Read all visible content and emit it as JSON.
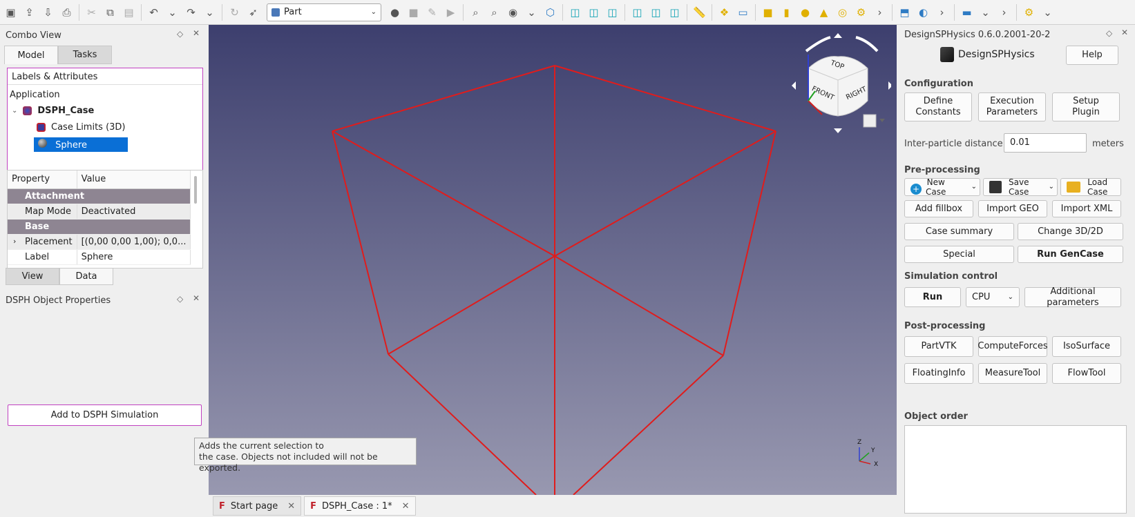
{
  "toolbar": {
    "workbench": "Part",
    "icons": [
      "new-file",
      "open-file",
      "save-file",
      "print",
      "cut",
      "copy",
      "paste",
      "undo",
      "dropdown",
      "redo",
      "dropdown",
      "refresh",
      "whats-this",
      "record-macro",
      "stop-macro",
      "edit-macro",
      "run-macro",
      "zoom-fit",
      "zoom-select",
      "draw-style",
      "view-iso",
      "view-front",
      "view-top",
      "view-right",
      "view-rear",
      "view-bottom",
      "view-left",
      "measure",
      "create-part",
      "create-group",
      "box",
      "cylinder",
      "sphere",
      "cone",
      "torus",
      "primitives",
      "more",
      "boolean",
      "shape-builder",
      "more",
      "view-box",
      "dropdown",
      "more",
      "screenshot",
      "dropdown"
    ]
  },
  "left": {
    "combo_title": "Combo View",
    "tab_model": "Model",
    "tab_tasks": "Tasks",
    "tree_header": "Labels & Attributes",
    "app_label": "Application",
    "tree": {
      "root": "DSPH_Case",
      "child1": "Case Limits (3D)",
      "child2": "Sphere"
    },
    "props": {
      "col_property": "Property",
      "col_value": "Value",
      "group1": "Attachment",
      "map_mode_key": "Map Mode",
      "map_mode_val": "Deactivated",
      "group2": "Base",
      "placement_key": "Placement",
      "placement_val": "[(0,00 0,00 1,00); 0,0...",
      "label_key": "Label",
      "label_val": "Sphere"
    },
    "tab_view": "View",
    "tab_data": "Data",
    "dsph_props_title": "DSPH Object Properties",
    "add_button": "Add to DSPH Simulation",
    "tooltip_line1": "Adds the current selection to",
    "tooltip_line2": "the case. Objects not included will not be exported."
  },
  "viewport": {
    "navcube_top": "TOP",
    "navcube_front": "FRONT",
    "navcube_right": "RIGHT",
    "axis_x": "X",
    "axis_y": "Y",
    "axis_z": "Z",
    "colors": {
      "edges": "#e01c1c",
      "bg_top": "#3d3f6e",
      "bg_bottom": "#9898b0"
    }
  },
  "doc_tabs": {
    "start": "Start page",
    "doc": "DSPH_Case : 1*"
  },
  "right": {
    "title": "DesignSPHysics 0.6.0.2001-20-2",
    "logo_text": "DesignSPHysics",
    "help": "Help",
    "configuration": "Configuration",
    "define_constants_1": "Define",
    "define_constants_2": "Constants",
    "execution_params_1": "Execution",
    "execution_params_2": "Parameters",
    "setup_plugin_1": "Setup",
    "setup_plugin_2": "Plugin",
    "dp_label": "Inter-particle distance:",
    "dp_value": "0.01",
    "dp_unit": "meters",
    "preprocessing": "Pre-processing",
    "new_case_1": "New",
    "new_case_2": "Case",
    "save_case_1": "Save",
    "save_case_2": "Case",
    "load_case_1": "Load",
    "load_case_2": "Case",
    "add_fillbox": "Add fillbox",
    "import_geo": "Import GEO",
    "import_xml": "Import XML",
    "case_summary": "Case summary",
    "change_3d2d": "Change 3D/2D",
    "special": "Special",
    "run_gencase": "Run GenCase",
    "simulation_control": "Simulation control",
    "run": "Run",
    "device": "CPU",
    "additional_params": "Additional parameters",
    "postprocessing": "Post-processing",
    "partvtk": "PartVTK",
    "computeforces": "ComputeForces",
    "isosurface": "IsoSurface",
    "floatinginfo": "FloatingInfo",
    "measuretool": "MeasureTool",
    "flowtool": "FlowTool",
    "object_order": "Object order"
  }
}
